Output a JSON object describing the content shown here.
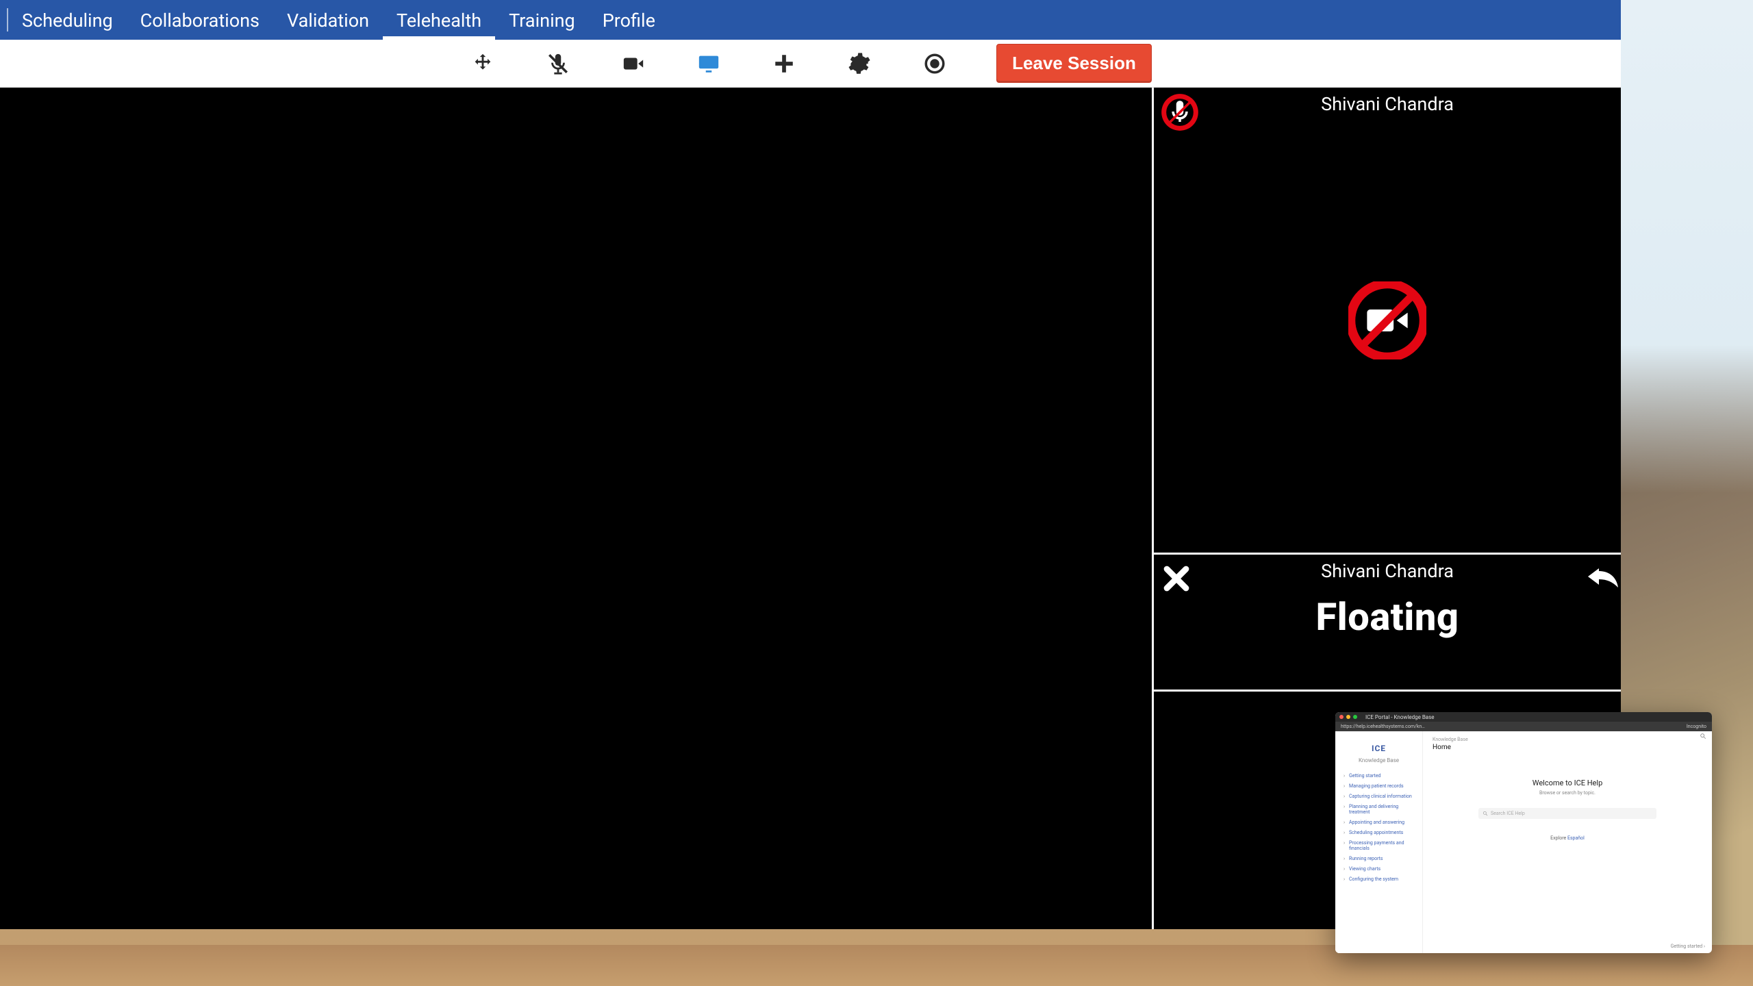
{
  "nav": {
    "tabs": [
      "Scheduling",
      "Collaborations",
      "Validation",
      "Telehealth",
      "Training",
      "Profile"
    ],
    "active_index": 3
  },
  "toolbar": {
    "icons": [
      "move",
      "mic-muted",
      "video",
      "screen-share",
      "add",
      "settings",
      "record"
    ],
    "active_icon": "screen-share",
    "leave_label": "Leave Session"
  },
  "participants": {
    "tile1": {
      "name": "Shivani Chandra",
      "mic_muted": true,
      "video_off": true
    },
    "tile2": {
      "name": "Shivani Chandra",
      "status_label": "Floating"
    }
  },
  "pip": {
    "tab_title": "ICE Portal - Knowledge Base",
    "url": "https://help.icehealthsystems.com/kn…",
    "incognito": "Incognito",
    "side_logo": "ICE",
    "side_sub": "Knowledge Base",
    "side_items": [
      "Getting started",
      "Managing patient records",
      "Capturing clinical information",
      "Planning and delivering treatment",
      "Appointing and answering",
      "Scheduling appointments",
      "Processing payments and financials",
      "Running reports",
      "Viewing charts",
      "Configuring the system"
    ],
    "breadcrumb": "Knowledge Base",
    "page_title": "Home",
    "welcome": "Welcome to ICE Help",
    "tagline": "Browse or search by topic.",
    "search_placeholder": "Search ICE Help",
    "espanol_prefix": "Explore ",
    "espanol_link": "Español",
    "footer": "Getting started  ›"
  }
}
